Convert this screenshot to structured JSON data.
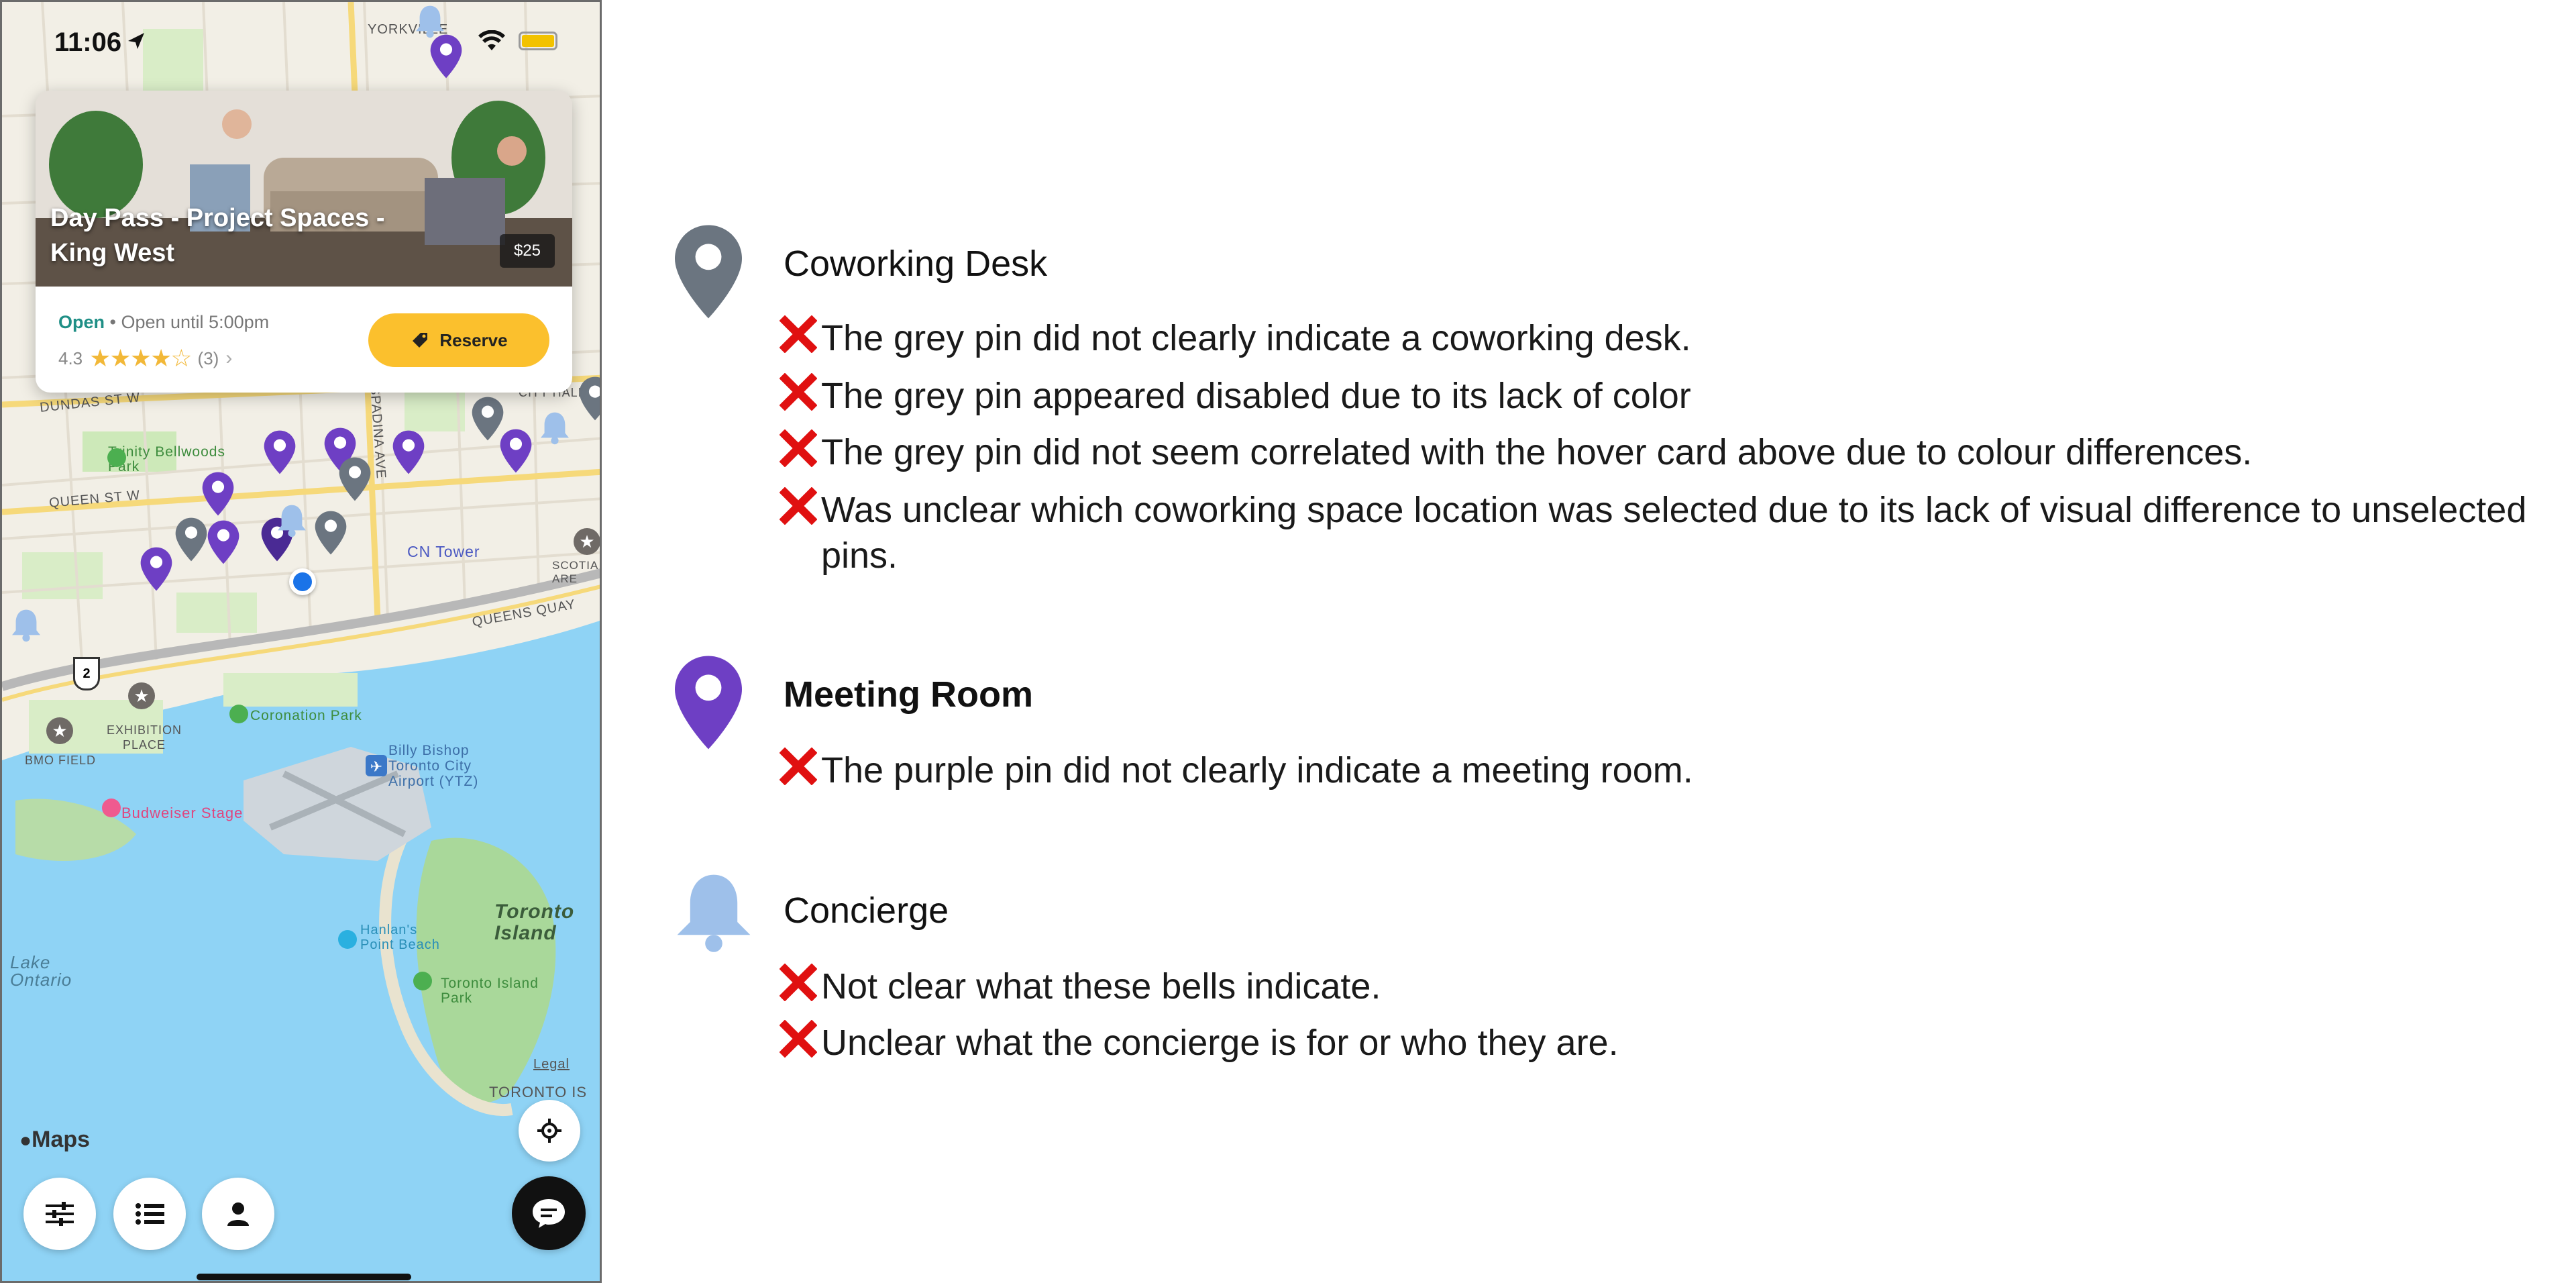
{
  "status_bar": {
    "time": "11:06"
  },
  "card": {
    "title": "Day Pass - Project Spaces - King West",
    "price": "$25",
    "open_label": "Open",
    "hours": " • Open until 5:00pm",
    "rating": "4.3",
    "stars": "★★★★☆",
    "review_count": "(3)",
    "reserve_label": "Reserve"
  },
  "map": {
    "labels": {
      "yorkville": "YORKVILLE",
      "dundas": "DUNDAS ST W",
      "queen": "QUEEN ST W",
      "spadina": "SPADINA AVE",
      "city_hall": "CITY HALL",
      "trinity": "Trinity Bellwoods Park",
      "cn_tower": "CN Tower",
      "queens_quay": "QUEENS QUAY",
      "scotia": "SCOTIA ARE",
      "exhibition": "EXHIBITION PLACE",
      "bmo": "BMO FIELD",
      "coronation": "Coronation Park",
      "billy_bishop": "Billy Bishop Toronto City Airport (YTZ)",
      "budweiser": "Budweiser Stage",
      "hanlans": "Hanlan's Point Beach",
      "toronto_island": "Toronto Island",
      "toronto_island_park": "Toronto Island Park",
      "lake_ontario": "Lake Ontario",
      "legal": "Legal",
      "toronto_is_caps": "TORONTO IS",
      "highway": "2"
    },
    "attribution": "Maps"
  },
  "sections": [
    {
      "title": "Coworking Desk",
      "icon": "grey-pin-icon",
      "color": "#6b7580",
      "issues": [
        "The grey pin did not clearly indicate a coworking desk.",
        "The grey pin appeared disabled due to its lack of color",
        "The grey pin did not seem correlated with the hover card above due to colour differences.",
        "Was unclear which coworking space location was selected due to its lack of visual difference to unselected pins."
      ]
    },
    {
      "title": "Meeting Room",
      "icon": "purple-pin-icon",
      "color": "#6e3fc4",
      "issues": [
        "The purple pin did not clearly indicate a meeting room."
      ]
    },
    {
      "title": "Concierge",
      "icon": "bell-icon",
      "color": "#9ec0ea",
      "issues": [
        "Not clear what these bells indicate.",
        "Unclear what the concierge is for or who they are."
      ]
    }
  ],
  "colors": {
    "x_mark": "#e01010",
    "reserve": "#fbc02d",
    "user_location": "#1a73e8"
  }
}
